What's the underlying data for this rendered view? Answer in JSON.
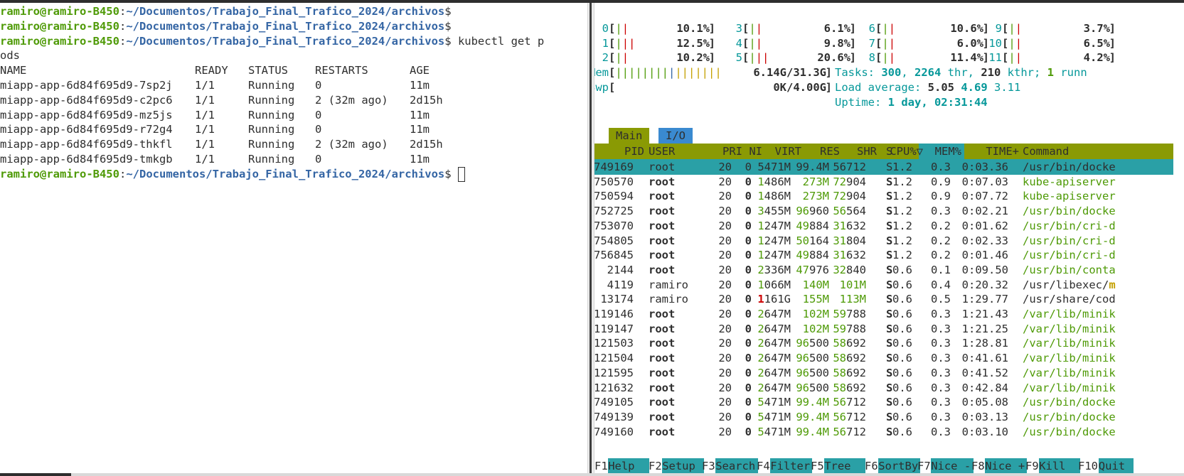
{
  "terminal": {
    "prompt_user": "ramiro@ramiro-B450",
    "prompt_sep": ":",
    "prompt_path": "~/Documentos/Trabajo_Final_Trafico_2024/archivos",
    "prompt_end": "$",
    "command_part1": " kubectl get p",
    "command_part2": "ods",
    "table_header": [
      "NAME",
      "READY",
      "STATUS",
      "RESTARTS",
      "AGE"
    ],
    "pods": [
      {
        "name": "miapp-app-6d84f695d9-7sp2j",
        "ready": "1/1",
        "status": "Running",
        "restarts": "0",
        "age": "11m"
      },
      {
        "name": "miapp-app-6d84f695d9-c2pc6",
        "ready": "1/1",
        "status": "Running",
        "restarts": "2 (32m ago)",
        "age": "2d15h"
      },
      {
        "name": "miapp-app-6d84f695d9-mz5js",
        "ready": "1/1",
        "status": "Running",
        "restarts": "0",
        "age": "11m"
      },
      {
        "name": "miapp-app-6d84f695d9-r72g4",
        "ready": "1/1",
        "status": "Running",
        "restarts": "0",
        "age": "11m"
      },
      {
        "name": "miapp-app-6d84f695d9-thkfl",
        "ready": "1/1",
        "status": "Running",
        "restarts": "2 (32m ago)",
        "age": "2d15h"
      },
      {
        "name": "miapp-app-6d84f695d9-tmkgb",
        "ready": "1/1",
        "status": "Running",
        "restarts": "0",
        "age": "11m"
      }
    ]
  },
  "htop": {
    "cpus": [
      {
        "id": "0",
        "bar_g": "|",
        "bar_r": "|",
        "pct": "10.1%"
      },
      {
        "id": "1",
        "bar_g": "|",
        "bar_r": "||",
        "pct": "12.5%"
      },
      {
        "id": "2",
        "bar_g": "|",
        "bar_r": "|",
        "pct": "10.2%"
      },
      {
        "id": "3",
        "bar_g": "|",
        "bar_r": "|",
        "pct": "6.1%"
      },
      {
        "id": "4",
        "bar_g": "|",
        "bar_r": "|",
        "pct": "9.8%"
      },
      {
        "id": "5",
        "bar_g": "|",
        "bar_r": "||",
        "pct": "20.6%"
      },
      {
        "id": "6",
        "bar_g": "|",
        "bar_r": "|",
        "pct": "10.6%"
      },
      {
        "id": "7",
        "bar_g": "|",
        "bar_r": "|",
        "pct": "6.0%"
      },
      {
        "id": "8",
        "bar_g": "|",
        "bar_r": "|",
        "pct": "11.4%"
      },
      {
        "id": "9",
        "bar_g": "|",
        "bar_r": "|",
        "pct": "3.7%"
      },
      {
        "id": "10",
        "bar_g": "|",
        "bar_r": "|",
        "pct": "6.5%"
      },
      {
        "id": "11",
        "bar_g": "|",
        "bar_r": "|",
        "pct": "4.2%"
      }
    ],
    "mem": {
      "label": "Mem",
      "bar_g": "||||||||",
      "bar_b": "|",
      "bar_y": "|||||||",
      "value": "6.14G/31.3G"
    },
    "swp": {
      "label": "Swp",
      "value": "0K/4.00G"
    },
    "tasks": {
      "label": "Tasks:",
      "tasks": "300",
      "thr": "2264",
      "thr_label": "thr,",
      "kthr": "210",
      "kthr_label": "kthr;",
      "running": "1",
      "running_label": "runn"
    },
    "load": {
      "label": "Load average:",
      "l1": "5.05",
      "l5": "4.69",
      "l15": "3.11"
    },
    "uptime": {
      "label": "Uptime:",
      "value": "1 day, 02:31:44"
    },
    "tabs": [
      "Main",
      "I/O"
    ],
    "columns": [
      "PID",
      "USER",
      "PRI",
      "NI",
      "VIRT",
      "RES",
      "SHR",
      "S",
      "CPU%▽",
      "MEM%",
      "TIME+",
      "Command"
    ],
    "processes": [
      {
        "pid": "749169",
        "user": "root",
        "pri": "20",
        "ni": "0",
        "virt": "5471M",
        "res": "99.4M",
        "shr": "56712",
        "s": "S",
        "cpu": "1.2",
        "mem": "0.3",
        "time": "0:03.36",
        "cmd": "/usr/bin/docke"
      },
      {
        "pid": "750570",
        "user": "root",
        "pri": "20",
        "ni": "0",
        "virt": "1486M",
        "res": "273M",
        "shr": "72904",
        "s": "S",
        "cpu": "1.2",
        "mem": "0.9",
        "time": "0:07.03",
        "cmd": "kube-apiserver"
      },
      {
        "pid": "750594",
        "user": "root",
        "pri": "20",
        "ni": "0",
        "virt": "1486M",
        "res": "273M",
        "shr": "72904",
        "s": "S",
        "cpu": "1.2",
        "mem": "0.9",
        "time": "0:07.72",
        "cmd": "kube-apiserver"
      },
      {
        "pid": "752725",
        "user": "root",
        "pri": "20",
        "ni": "0",
        "virt": "3455M",
        "res": "96960",
        "shr": "56564",
        "s": "S",
        "cpu": "1.2",
        "mem": "0.3",
        "time": "0:02.21",
        "cmd": "/usr/bin/docke"
      },
      {
        "pid": "753070",
        "user": "root",
        "pri": "20",
        "ni": "0",
        "virt": "1247M",
        "res": "49884",
        "shr": "31632",
        "s": "S",
        "cpu": "1.2",
        "mem": "0.2",
        "time": "0:01.62",
        "cmd": "/usr/bin/cri-d"
      },
      {
        "pid": "754805",
        "user": "root",
        "pri": "20",
        "ni": "0",
        "virt": "1247M",
        "res": "50164",
        "shr": "31804",
        "s": "S",
        "cpu": "1.2",
        "mem": "0.2",
        "time": "0:02.33",
        "cmd": "/usr/bin/cri-d"
      },
      {
        "pid": "756845",
        "user": "root",
        "pri": "20",
        "ni": "0",
        "virt": "1247M",
        "res": "49884",
        "shr": "31632",
        "s": "S",
        "cpu": "1.2",
        "mem": "0.2",
        "time": "0:01.46",
        "cmd": "/usr/bin/cri-d"
      },
      {
        "pid": "2144",
        "user": "root",
        "pri": "20",
        "ni": "0",
        "virt": "2336M",
        "res": "47976",
        "shr": "32840",
        "s": "S",
        "cpu": "0.6",
        "mem": "0.1",
        "time": "0:09.50",
        "cmd": "/usr/bin/conta"
      },
      {
        "pid": "4119",
        "user": "ramiro",
        "pri": "20",
        "ni": "0",
        "virt": "1066M",
        "res": "140M",
        "shr": "101M",
        "s": "S",
        "cpu": "0.6",
        "mem": "0.4",
        "time": "0:20.32",
        "cmd": "/usr/libexec/",
        "cmd_hl": "m"
      },
      {
        "pid": "13174",
        "user": "ramiro",
        "pri": "20",
        "ni": "0",
        "virt_red": "1",
        "virt": "161G",
        "res": "155M",
        "shr": "113M",
        "s": "S",
        "cpu": "0.6",
        "mem": "0.5",
        "time": "1:29.77",
        "cmd": "/usr/share/cod"
      },
      {
        "pid": "119146",
        "user": "root",
        "pri": "20",
        "ni": "0",
        "virt": "2647M",
        "res": "102M",
        "shr": "59788",
        "s": "S",
        "cpu": "0.6",
        "mem": "0.3",
        "time": "1:21.43",
        "cmd": "/var/lib/minik"
      },
      {
        "pid": "119147",
        "user": "root",
        "pri": "20",
        "ni": "0",
        "virt": "2647M",
        "res": "102M",
        "shr": "59788",
        "s": "S",
        "cpu": "0.6",
        "mem": "0.3",
        "time": "1:21.25",
        "cmd": "/var/lib/minik"
      },
      {
        "pid": "121503",
        "user": "root",
        "pri": "20",
        "ni": "0",
        "virt": "2647M",
        "res": "96500",
        "shr": "58692",
        "s": "S",
        "cpu": "0.6",
        "mem": "0.3",
        "time": "1:28.81",
        "cmd": "/var/lib/minik"
      },
      {
        "pid": "121504",
        "user": "root",
        "pri": "20",
        "ni": "0",
        "virt": "2647M",
        "res": "96500",
        "shr": "58692",
        "s": "S",
        "cpu": "0.6",
        "mem": "0.3",
        "time": "0:41.61",
        "cmd": "/var/lib/minik"
      },
      {
        "pid": "121595",
        "user": "root",
        "pri": "20",
        "ni": "0",
        "virt": "2647M",
        "res": "96500",
        "shr": "58692",
        "s": "S",
        "cpu": "0.6",
        "mem": "0.3",
        "time": "0:41.52",
        "cmd": "/var/lib/minik"
      },
      {
        "pid": "121632",
        "user": "root",
        "pri": "20",
        "ni": "0",
        "virt": "2647M",
        "res": "96500",
        "shr": "58692",
        "s": "S",
        "cpu": "0.6",
        "mem": "0.3",
        "time": "0:42.84",
        "cmd": "/var/lib/minik"
      },
      {
        "pid": "749105",
        "user": "root",
        "pri": "20",
        "ni": "0",
        "virt": "5471M",
        "res": "99.4M",
        "shr": "56712",
        "s": "S",
        "cpu": "0.6",
        "mem": "0.3",
        "time": "0:05.08",
        "cmd": "/usr/bin/docke"
      },
      {
        "pid": "749139",
        "user": "root",
        "pri": "20",
        "ni": "0",
        "virt": "5471M",
        "res": "99.4M",
        "shr": "56712",
        "s": "S",
        "cpu": "0.6",
        "mem": "0.3",
        "time": "0:03.13",
        "cmd": "/usr/bin/docke"
      },
      {
        "pid": "749160",
        "user": "root",
        "pri": "20",
        "ni": "0",
        "virt": "5471M",
        "res": "99.4M",
        "shr": "56712",
        "s": "S",
        "cpu": "0.6",
        "mem": "0.3",
        "time": "0:03.10",
        "cmd": "/usr/bin/docke"
      }
    ],
    "fkeys": [
      {
        "key": "F1",
        "label": "Help"
      },
      {
        "key": "F2",
        "label": "Setup"
      },
      {
        "key": "F3",
        "label": "Search"
      },
      {
        "key": "F4",
        "label": "Filter"
      },
      {
        "key": "F5",
        "label": "Tree"
      },
      {
        "key": "F6",
        "label": "SortBy"
      },
      {
        "key": "F7",
        "label": "Nice -"
      },
      {
        "key": "F8",
        "label": "Nice +"
      },
      {
        "key": "F9",
        "label": "Kill"
      },
      {
        "key": "F10",
        "label": "Quit"
      }
    ]
  }
}
